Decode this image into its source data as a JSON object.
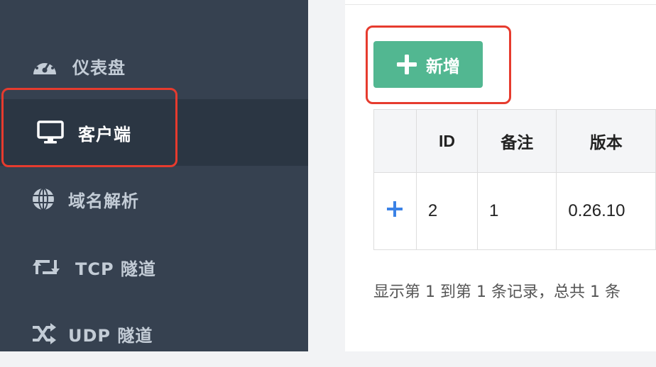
{
  "sidebar": {
    "items": [
      {
        "label": "仪表盘",
        "icon": "dashboard-icon"
      },
      {
        "label": "客户端",
        "icon": "monitor-icon",
        "active": true
      },
      {
        "label": "域名解析",
        "icon": "globe-icon"
      },
      {
        "label": "TCP 隧道",
        "icon": "retweet-icon"
      },
      {
        "label": "UDP 隧道",
        "icon": "random-icon"
      }
    ]
  },
  "toolbar": {
    "add_label": "新增"
  },
  "table": {
    "headers": [
      "",
      "ID",
      "备注",
      "版本"
    ],
    "rows": [
      {
        "expand": "+",
        "id": "2",
        "remark": "1",
        "version": "0.26.10"
      }
    ]
  },
  "pagination": {
    "summary": "显示第 1 到第 1 条记录，总共 1 条"
  },
  "colors": {
    "sidebar": "#364150",
    "sidebar_active": "#2b3643",
    "add_button": "#52b791",
    "highlight": "#e63b2e"
  }
}
